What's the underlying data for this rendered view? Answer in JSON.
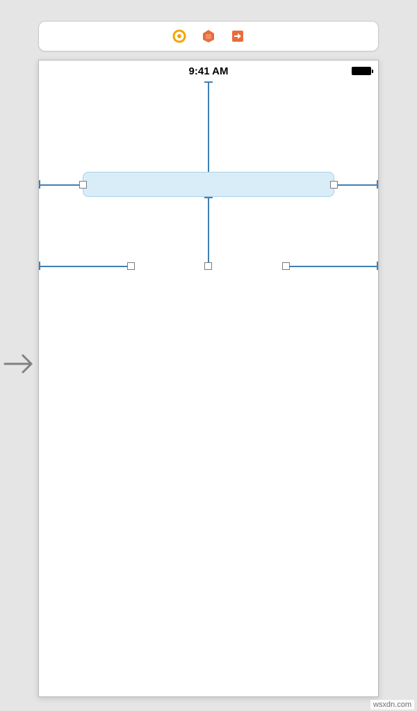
{
  "toolbar": {
    "icons": [
      "first-responder-icon",
      "exit-icon",
      "storyboard-reference-icon"
    ]
  },
  "status_bar": {
    "time": "9:41 AM"
  },
  "watermark": "wsxdn.com"
}
